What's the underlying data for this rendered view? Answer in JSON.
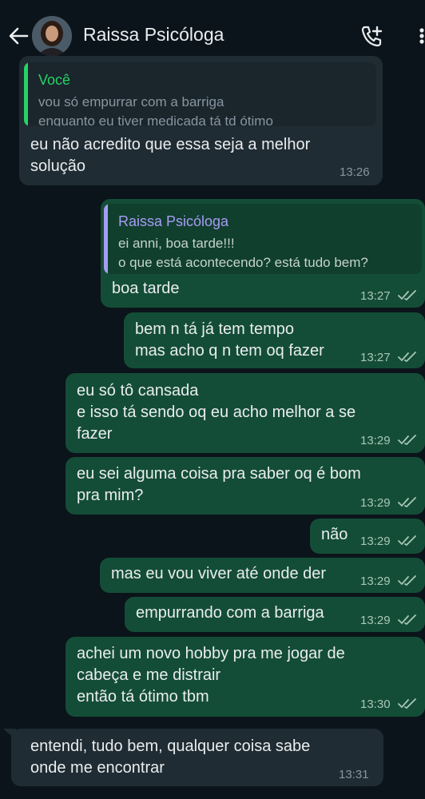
{
  "header": {
    "contact_name": "Raissa Psicóloga",
    "back_icon": "arrow-left-icon",
    "call_icon": "add-call-icon",
    "menu_icon": "more-vertical-icon"
  },
  "messages": [
    {
      "direction": "incoming",
      "quote": {
        "author": "Você",
        "lines": [
          "vou só empurrar com a barriga",
          "enquanto eu tiver medicada tá td ótimo"
        ]
      },
      "text": "eu não acredito que essa seja a melhor\nsolução",
      "time": "13:26"
    },
    {
      "direction": "outgoing",
      "quote": {
        "author": "Raissa Psicóloga",
        "lines": [
          "ei anni, boa tarde!!!",
          "o que está acontecendo? está tudo bem?"
        ]
      },
      "text": "boa tarde",
      "time": "13:27"
    },
    {
      "direction": "outgoing",
      "text": "bem n tá já tem tempo\nmas acho q n tem oq fazer",
      "time": "13:27"
    },
    {
      "direction": "outgoing",
      "text": "eu só tô cansada\ne isso tá sendo oq eu acho melhor a se\nfazer",
      "time": "13:29"
    },
    {
      "direction": "outgoing",
      "text": "eu sei alguma coisa pra saber oq é bom\npra mim?",
      "time": "13:29"
    },
    {
      "direction": "outgoing",
      "text": "não",
      "time": "13:29"
    },
    {
      "direction": "outgoing",
      "text": "mas eu vou viver até onde der",
      "time": "13:29"
    },
    {
      "direction": "outgoing",
      "text": "empurrando com a barriga",
      "time": "13:29"
    },
    {
      "direction": "outgoing",
      "text": "achei um novo hobby pra me jogar de\ncabeça e me distrair\nentão tá ótimo tbm",
      "time": "13:30"
    },
    {
      "direction": "incoming",
      "text": "entendi, tudo bem, qualquer coisa sabe\nonde me encontrar",
      "time": "13:31"
    }
  ],
  "colors": {
    "background": "#0b141a",
    "incoming_bubble": "#202c33",
    "outgoing_bubble": "#144d37",
    "quote_you": "#25d366",
    "quote_contact": "#a79bf5",
    "read_ticks": "#a8c7b8"
  }
}
